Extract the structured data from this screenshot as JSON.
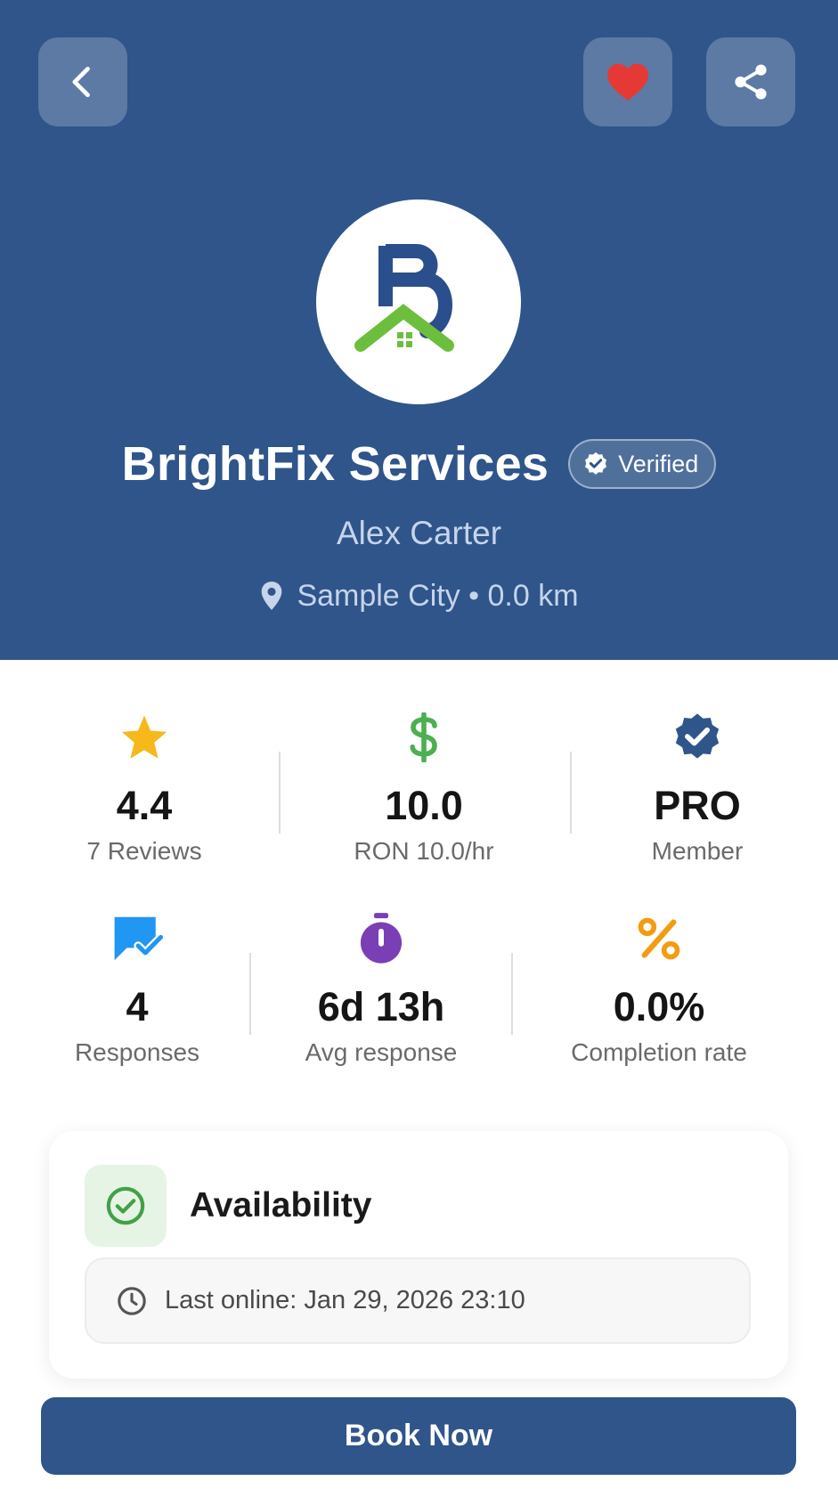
{
  "header": {
    "business_name": "BrightFix Services",
    "verified_label": "Verified",
    "owner_name": "Alex Carter",
    "location": "Sample City • 0.0 km"
  },
  "stats_row1": [
    {
      "value": "4.4",
      "label": "7 Reviews",
      "icon": "star-icon"
    },
    {
      "value": "10.0",
      "label": "RON 10.0/hr",
      "icon": "dollar-icon"
    },
    {
      "value": "PRO",
      "label": "Member",
      "icon": "verified-badge-icon"
    }
  ],
  "stats_row2": [
    {
      "value": "4",
      "label": "Responses",
      "icon": "chat-check-icon"
    },
    {
      "value": "6d 13h",
      "label": "Avg response",
      "icon": "stopwatch-icon"
    },
    {
      "value": "0.0%",
      "label": "Completion rate",
      "icon": "percent-icon"
    }
  ],
  "availability": {
    "title": "Availability",
    "last_online": "Last online: Jan 29, 2026 23:10"
  },
  "actions": {
    "book_label": "Book Now"
  },
  "colors": {
    "primary": "#2f558a",
    "star": "#f6b81a",
    "dollar": "#4caf50",
    "heart": "#e53935",
    "chat": "#2196f3",
    "stopwatch": "#7b3fb5",
    "percent": "#f39c12",
    "success": "#43a047"
  }
}
